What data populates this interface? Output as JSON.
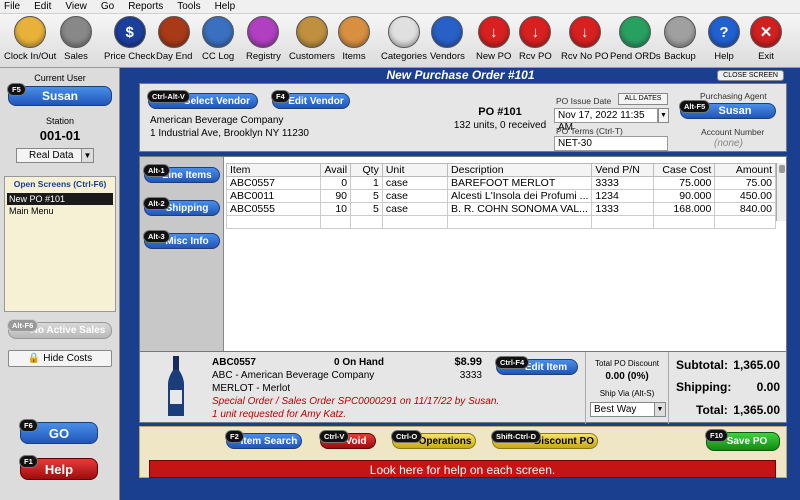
{
  "menu": [
    "File",
    "Edit",
    "View",
    "Go",
    "Reports",
    "Tools",
    "Help"
  ],
  "toolbar": [
    {
      "label": "Clock In/Out",
      "icon": "clock-icon",
      "color": "#e8b23a"
    },
    {
      "label": "Sales",
      "icon": "cash-register-icon",
      "color": "#888888"
    },
    {
      "label": "Price Check",
      "icon": "dollar-icon",
      "color": "#1c3e9c"
    },
    {
      "label": "Day End",
      "icon": "calendar-icon",
      "color": "#a83a18"
    },
    {
      "label": "CC Log",
      "icon": "credit-card-icon",
      "color": "#3a70c0"
    },
    {
      "label": "Registry",
      "icon": "gift-icon",
      "color": "#b040c0"
    },
    {
      "label": "Customers",
      "icon": "customers-icon",
      "color": "#c09040"
    },
    {
      "label": "Items",
      "icon": "items-icon",
      "color": "#d89040"
    },
    {
      "label": "Categories",
      "icon": "categories-icon",
      "color": "#e0e0e0"
    },
    {
      "label": "Vendors",
      "icon": "vendors-icon",
      "color": "#2860c8"
    },
    {
      "label": "New PO",
      "icon": "new-po-icon",
      "color": "#d82020"
    },
    {
      "label": "Rcv PO",
      "icon": "receive-po-icon",
      "color": "#d82020"
    },
    {
      "label": "Rcv No PO",
      "icon": "receive-no-po-icon",
      "color": "#d82020"
    },
    {
      "label": "Pend ORDs",
      "icon": "pending-orders-icon",
      "color": "#28a060"
    },
    {
      "label": "Backup",
      "icon": "backup-icon",
      "color": "#a0a0a0"
    },
    {
      "label": "Help",
      "icon": "help-icon",
      "color": "#2060d0"
    },
    {
      "label": "Exit",
      "icon": "exit-icon",
      "color": "#d02020"
    }
  ],
  "left": {
    "current_user_label": "Current User",
    "user_key": "F5",
    "user": "Susan",
    "station_label": "Station",
    "station": "001-01",
    "data_mode": "Real Data",
    "open_screens_title": "Open Screens (Ctrl-F6)",
    "open_screens": [
      "New PO #101",
      "Main Menu"
    ],
    "no_sales_key": "Alt-F6",
    "no_sales": "No Active Sales",
    "hide_costs": "Hide Costs",
    "go_key": "F6",
    "go": "GO",
    "help_key": "F1",
    "help": "Help"
  },
  "main": {
    "title": "New Purchase Order #101",
    "close": "CLOSE SCREEN",
    "select_vendor_key": "Ctrl-Alt-V",
    "select_vendor": "Select Vendor",
    "edit_vendor_key": "F4",
    "edit_vendor": "Edit Vendor",
    "vendor_name": "American Beverage Company",
    "vendor_address": "1 Industrial Ave, Brooklyn NY  11230",
    "po_number": "PO #101",
    "po_summary": "132 units, 0 received",
    "issue_date_label": "PO Issue Date",
    "all_dates": "ALL DATES",
    "issue_date": "Nov 17, 2022 11:35 AM",
    "terms_label": "PO Terms (Ctrl-T)",
    "terms": "NET-30",
    "agent_label": "Purchasing Agent",
    "agent_key": "Alt-F5",
    "agent": "Susan",
    "account_label": "Account Number",
    "account": "(none)"
  },
  "tabs": [
    {
      "key": "Alt-1",
      "label": "Line Items"
    },
    {
      "key": "Alt-2",
      "label": "Shipping"
    },
    {
      "key": "Alt-3",
      "label": "Misc Info"
    }
  ],
  "table": {
    "columns": [
      "Item",
      "Avail",
      "Qty",
      "Unit",
      "Description",
      "Vend P/N",
      "Case Cost",
      "Amount"
    ],
    "rows": [
      [
        "ABC0557",
        "0",
        "1",
        "case",
        "BAREFOOT MERLOT",
        "3333",
        "75.000",
        "75.00"
      ],
      [
        "ABC0011",
        "90",
        "5",
        "case",
        "Alcesti L'Insola dei Profumi ...",
        "1234",
        "90.000",
        "450.00"
      ],
      [
        "ABC0555",
        "10",
        "5",
        "case",
        "B. R. COHN SONOMA VAL...",
        "1333",
        "168.000",
        "840.00"
      ]
    ]
  },
  "detail": {
    "item": "ABC0557",
    "on_hand": "0 On Hand",
    "price": "$8.99",
    "vendor_line": "ABC - American Beverage Company",
    "vendor_code": "3333",
    "desc": "MERLOT - Merlot",
    "special": "Special Order / Sales Order SPC0000291 on 11/17/22 by Susan.",
    "requested": "1 unit requested for Amy Katz.",
    "edit_item_key": "Ctrl-F4",
    "edit_item": "Edit Item",
    "discount_label": "Total PO Discount",
    "discount": "0.00 (0%)",
    "ship_via_label": "Ship Via (Alt-S)",
    "ship_via": "Best Way",
    "subtotal_label": "Subtotal:",
    "subtotal": "1,365.00",
    "shipping_label": "Shipping:",
    "shipping": "0.00",
    "total_label": "Total:",
    "total": "1,365.00"
  },
  "actions": {
    "item_search_key": "F2",
    "item_search": "Item Search",
    "void_key": "Ctrl-V",
    "void": "Void",
    "operations_key": "Ctrl-O",
    "operations": "Operations",
    "discount_key": "Shift-Ctrl-D",
    "discount": "Discount PO",
    "save_key": "F10",
    "save": "Save PO",
    "help_bar": "Look here for help on each screen."
  }
}
